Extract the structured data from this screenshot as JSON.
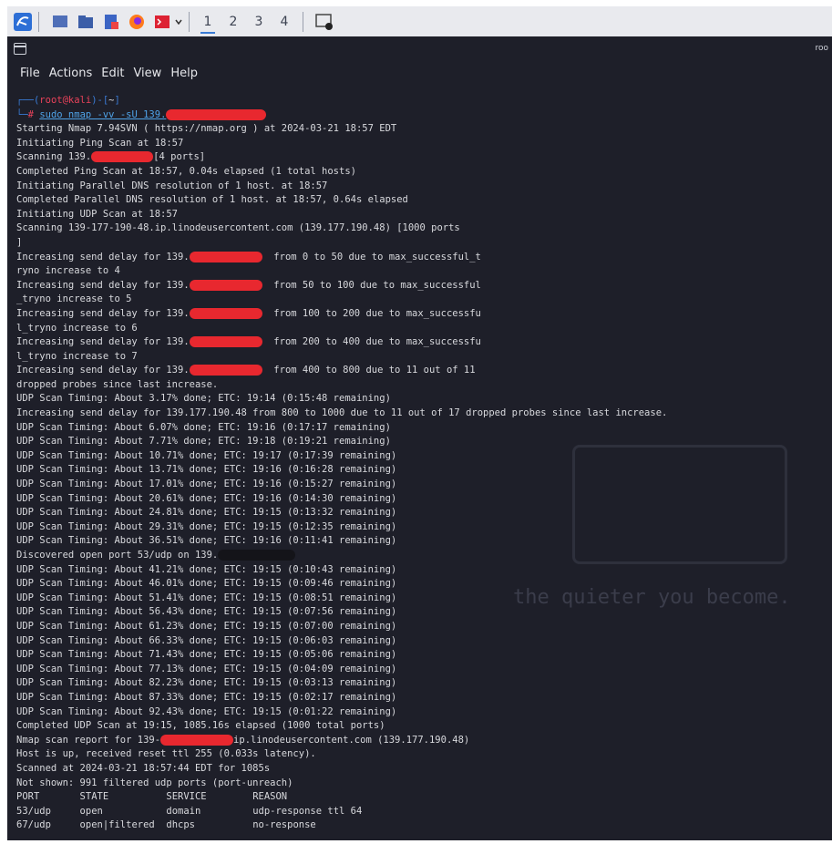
{
  "taskbar": {
    "workspaces": [
      "1",
      "2",
      "3",
      "4"
    ],
    "active_workspace": 0,
    "accent": "#3a7bd5"
  },
  "terminal": {
    "title": "roo",
    "menu": [
      "File",
      "Actions",
      "Edit",
      "View",
      "Help"
    ],
    "prompt": {
      "user": "root@kali",
      "dir": "~",
      "command": "sudo nmap -vv -sU 139."
    },
    "output": [
      "Starting Nmap 7.94SVN ( https://nmap.org ) at 2024-03-21 18:57 EDT",
      "Initiating Ping Scan at 18:57",
      "Scanning 139.",
      "[4 ports]",
      "Completed Ping Scan at 18:57, 0.04s elapsed (1 total hosts)",
      "Initiating Parallel DNS resolution of 1 host. at 18:57",
      "Completed Parallel DNS resolution of 1 host. at 18:57, 0.64s elapsed",
      "Initiating UDP Scan at 18:57",
      "Scanning 139-177-190-48.ip.linodeusercontent.com (139.177.190.48) [1000 ports",
      "]",
      "Increasing send delay for 139.",
      "from 0 to 50 due to max_successful_t",
      "ryno increase to 4",
      "from 50 to 100 due to max_successful",
      "_tryno increase to 5",
      "from 100 to 200 due to max_successfu",
      "l_tryno increase to 6",
      "from 200 to 400 due to max_successfu",
      "l_tryno increase to 7",
      "from 400 to 800 due to 11 out of 11",
      "dropped probes since last increase.",
      "UDP Scan Timing: About 3.17% done; ETC: 19:14 (0:15:48 remaining)",
      "Increasing send delay for 139.177.190.48 from 800 to 1000 due to 11 out of 17 dropped probes since last increase.",
      "UDP Scan Timing: About 6.07% done; ETC: 19:16 (0:17:17 remaining)",
      "UDP Scan Timing: About 7.71% done; ETC: 19:18 (0:19:21 remaining)",
      "UDP Scan Timing: About 10.71% done; ETC: 19:17 (0:17:39 remaining)",
      "UDP Scan Timing: About 13.71% done; ETC: 19:16 (0:16:28 remaining)",
      "UDP Scan Timing: About 17.01% done; ETC: 19:16 (0:15:27 remaining)",
      "UDP Scan Timing: About 20.61% done; ETC: 19:16 (0:14:30 remaining)",
      "UDP Scan Timing: About 24.81% done; ETC: 19:15 (0:13:32 remaining)",
      "UDP Scan Timing: About 29.31% done; ETC: 19:15 (0:12:35 remaining)",
      "UDP Scan Timing: About 36.51% done; ETC: 19:16 (0:11:41 remaining)",
      "Discovered open port 53/udp on 139.",
      "UDP Scan Timing: About 41.21% done; ETC: 19:15 (0:10:43 remaining)",
      "UDP Scan Timing: About 46.01% done; ETC: 19:15 (0:09:46 remaining)",
      "UDP Scan Timing: About 51.41% done; ETC: 19:15 (0:08:51 remaining)",
      "UDP Scan Timing: About 56.43% done; ETC: 19:15 (0:07:56 remaining)",
      "UDP Scan Timing: About 61.23% done; ETC: 19:15 (0:07:00 remaining)",
      "UDP Scan Timing: About 66.33% done; ETC: 19:15 (0:06:03 remaining)",
      "UDP Scan Timing: About 71.43% done; ETC: 19:15 (0:05:06 remaining)",
      "UDP Scan Timing: About 77.13% done; ETC: 19:15 (0:04:09 remaining)",
      "UDP Scan Timing: About 82.23% done; ETC: 19:15 (0:03:13 remaining)",
      "UDP Scan Timing: About 87.33% done; ETC: 19:15 (0:02:17 remaining)",
      "UDP Scan Timing: About 92.43% done; ETC: 19:15 (0:01:22 remaining)",
      "Completed UDP Scan at 19:15, 1085.16s elapsed (1000 total ports)",
      "Nmap scan report for 139-",
      "ip.linodeusercontent.com (139.177.190.48)",
      "Host is up, received reset ttl 255 (0.033s latency).",
      "Scanned at 2024-03-21 18:57:44 EDT for 1085s",
      "Not shown: 991 filtered udp ports (port-unreach)"
    ],
    "ports_table": {
      "headers": [
        "PORT",
        "STATE",
        "SERVICE",
        "REASON"
      ],
      "rows": [
        [
          "53/udp",
          "open",
          "domain",
          "udp-response ttl 64"
        ],
        [
          "67/udp",
          "open|filtered",
          "dhcps",
          "no-response"
        ]
      ]
    },
    "watermark": "the quieter you become."
  }
}
